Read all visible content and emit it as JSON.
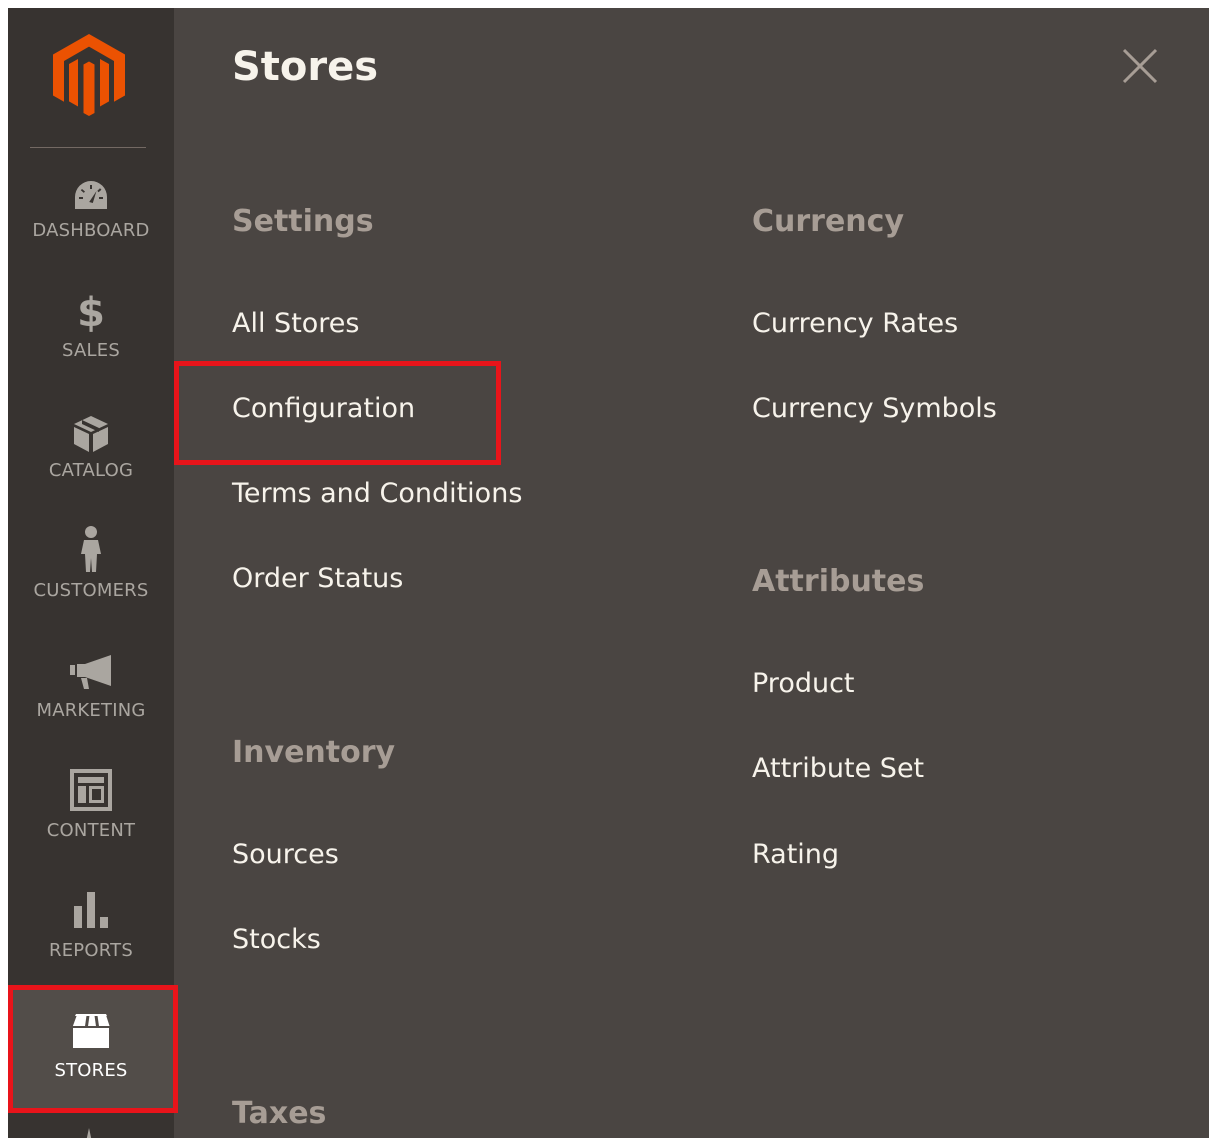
{
  "sidebar": {
    "items": [
      {
        "key": "dashboard",
        "label": "DASHBOARD",
        "icon": "dashboard-icon"
      },
      {
        "key": "sales",
        "label": "SALES",
        "icon": "dollar-icon"
      },
      {
        "key": "catalog",
        "label": "CATALOG",
        "icon": "box-icon"
      },
      {
        "key": "customers",
        "label": "CUSTOMERS",
        "icon": "person-icon"
      },
      {
        "key": "marketing",
        "label": "MARKETING",
        "icon": "megaphone-icon"
      },
      {
        "key": "content",
        "label": "CONTENT",
        "icon": "layout-icon"
      },
      {
        "key": "reports",
        "label": "REPORTS",
        "icon": "bar-chart-icon"
      },
      {
        "key": "stores",
        "label": "STORES",
        "icon": "storefront-icon",
        "active": true
      }
    ]
  },
  "panel": {
    "title": "Stores",
    "settings": {
      "heading": "Settings",
      "links": [
        "All Stores",
        "Configuration",
        "Terms and Conditions",
        "Order Status"
      ]
    },
    "inventory": {
      "heading": "Inventory",
      "links": [
        "Sources",
        "Stocks"
      ]
    },
    "taxes": {
      "heading": "Taxes"
    },
    "currency": {
      "heading": "Currency",
      "links": [
        "Currency Rates",
        "Currency Symbols"
      ]
    },
    "attributes": {
      "heading": "Attributes",
      "links": [
        "Product",
        "Attribute Set",
        "Rating"
      ]
    }
  },
  "colors": {
    "sidebar_bg": "#373330",
    "panel_bg": "#4a4542",
    "logo": "#eb5202",
    "highlight": "#e8141a",
    "heading": "#a79d95",
    "link": "#f7f3eb"
  }
}
